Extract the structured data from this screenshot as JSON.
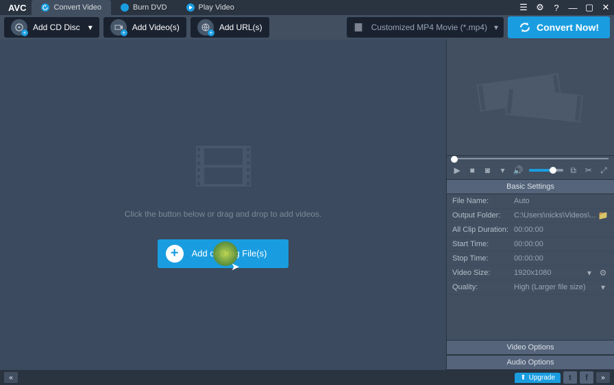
{
  "app": {
    "logo": "AVC",
    "tabs": [
      {
        "label": "Convert Video"
      },
      {
        "label": "Burn DVD"
      },
      {
        "label": "Play Video"
      }
    ]
  },
  "toolbar": {
    "add_cd": "Add CD Disc",
    "add_videos": "Add Video(s)",
    "add_urls": "Add URL(s)",
    "format": "Customized MP4 Movie (*.mp4)",
    "convert": "Convert Now!"
  },
  "stage": {
    "hint": "Click the button below or drag and drop to add videos.",
    "add_button": "Add or Drag File(s)"
  },
  "settings": {
    "header": "Basic Settings",
    "rows": {
      "file_name": {
        "label": "File Name:",
        "value": "Auto"
      },
      "output_folder": {
        "label": "Output Folder:",
        "value": "C:\\Users\\nicks\\Videos\\..."
      },
      "all_clip_duration": {
        "label": "All Clip Duration:",
        "value": "00:00:00"
      },
      "start_time": {
        "label": "Start Time:",
        "value": "00:00:00"
      },
      "stop_time": {
        "label": "Stop Time:",
        "value": "00:00:00"
      },
      "video_size": {
        "label": "Video Size:",
        "value": "1920x1080"
      },
      "quality": {
        "label": "Quality:",
        "value": "High (Larger file size)"
      }
    },
    "video_options": "Video Options",
    "audio_options": "Audio Options"
  },
  "statusbar": {
    "upgrade": "Upgrade"
  }
}
